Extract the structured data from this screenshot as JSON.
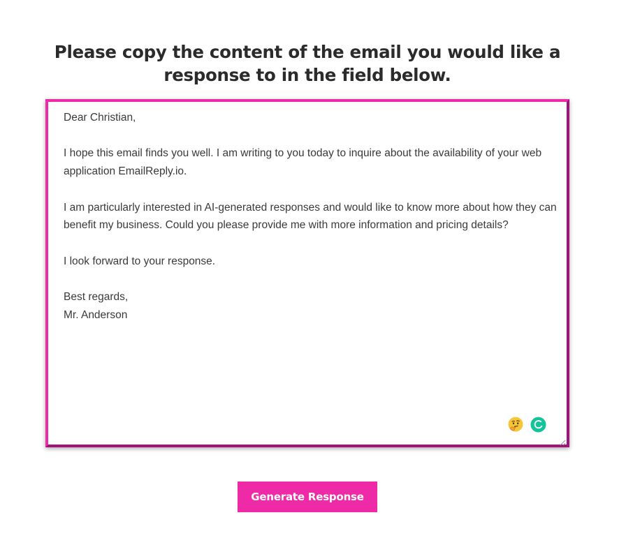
{
  "page": {
    "heading": "Please copy the content of the email you would like a response to in the field below."
  },
  "email_field": {
    "value": "Dear Christian,\n\nI hope this email finds you well. I am writing to you today to inquire about the availability of your web application EmailReply.io.\n\nI am particularly interested in AI-generated responses and would like to know more about how they can benefit my business. Could you please provide me with more information and pricing details?\n\nI look forward to your response.\n\nBest regards,\nMr. Anderson",
    "icons": [
      "thinking-face-emoji-icon",
      "grammarly-icon"
    ]
  },
  "actions": {
    "generate_label": "Generate Response"
  },
  "colors": {
    "accent": "#ee2aa6",
    "accent_dark": "#a3127a",
    "heading_text": "#2b2b2b",
    "body_text": "#3a3a3a",
    "grammarly": "#15c39a"
  }
}
